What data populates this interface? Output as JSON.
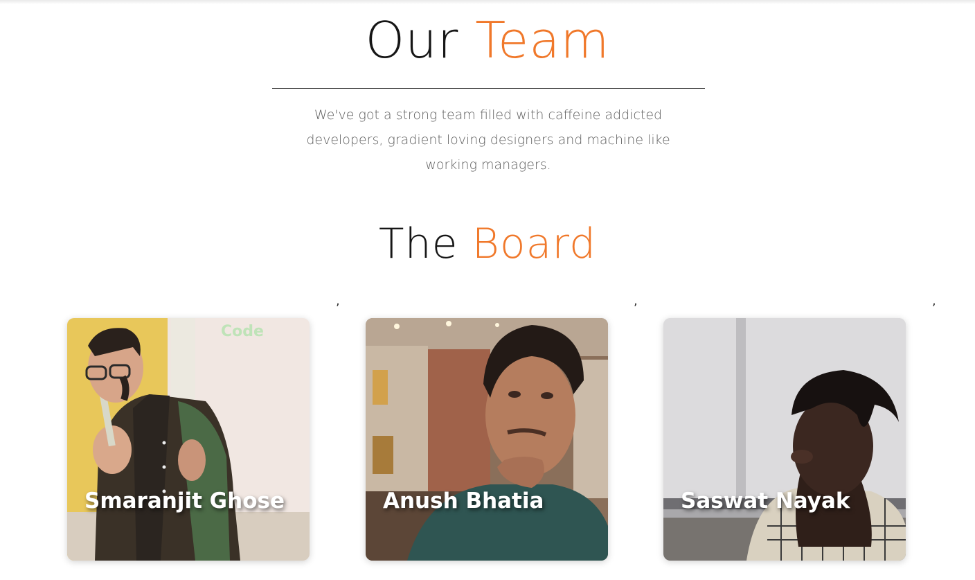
{
  "team_section": {
    "title_main": "Our",
    "title_accent": "Team",
    "description": "We've got a strong team filled with caffeine addicted developers, gradient loving designers and machine like working managers."
  },
  "board_section": {
    "title_main": "The",
    "title_accent": "Board",
    "separator": ",",
    "members": [
      {
        "name": "Smaranjit Ghose",
        "photo_label": "Code"
      },
      {
        "name": "Anush Bhatia"
      },
      {
        "name": "Saswat Nayak"
      }
    ]
  },
  "colors": {
    "accent": "#f0782a",
    "heading": "#161616",
    "body_text": "#5e5e5e"
  }
}
